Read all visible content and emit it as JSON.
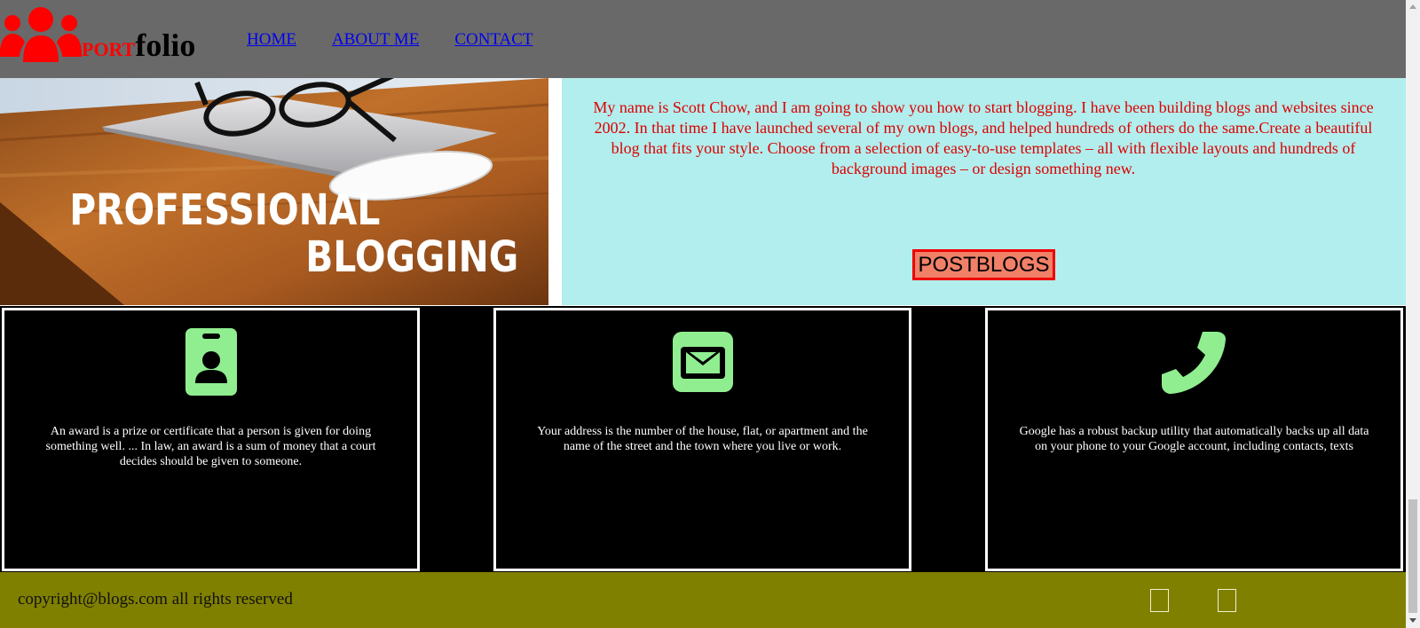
{
  "header": {
    "logo_port": "PORT",
    "logo_folio": "folio",
    "nav": [
      "HOME",
      "ABOUT ME",
      "CONTACT"
    ]
  },
  "hero": {
    "image_title_line1": "PROFESSIONAL",
    "image_title_line2": "BLOGGING",
    "intro_text": "My name is Scott Chow, and I am going to show you how to start blogging. I have been building blogs and websites since 2002. In that time I have launched several of my own blogs, and helped hundreds of others do the same.Create a beautiful blog that fits your style. Choose from a selection of easy-to-use templates – all with flexible layouts and hundreds of background images – or design something new.",
    "button_label": "POSTBLOGS"
  },
  "cards": [
    {
      "icon": "id-badge-icon",
      "text": "An award is a prize or certificate that a person is given for doing something well. ... In law, an award is a sum of money that a court decides should be given to someone."
    },
    {
      "icon": "envelope-icon",
      "text": "Your address is the number of the house, flat, or apartment and the name of the street and the town where you live or work."
    },
    {
      "icon": "phone-icon",
      "text": "Google has a robust backup utility that automatically backs up all data on your phone to your Google account, including contacts, texts"
    }
  ],
  "footer": {
    "copyright": "copyright@blogs.com all rights reserved"
  },
  "colors": {
    "header_bg": "#696969",
    "accent_red": "#ff0000",
    "hero_panel_bg": "#b2eeed",
    "button_bg": "#f08068",
    "icon_green": "#90ee90",
    "footer_bg": "#808000"
  }
}
